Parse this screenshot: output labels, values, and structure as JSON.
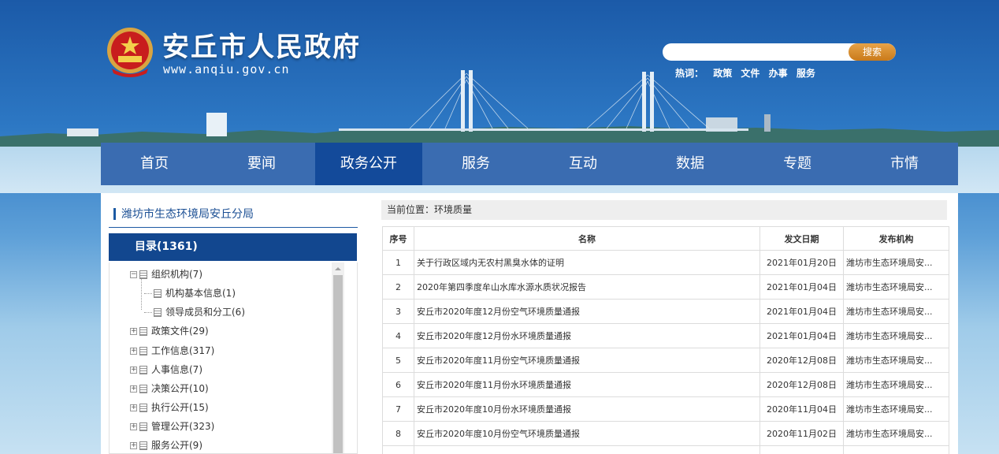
{
  "header": {
    "site_title": "安丘市人民政府",
    "site_url": "www.anqiu.gov.cn",
    "search": {
      "placeholder": "",
      "button_label": "搜索"
    },
    "hotwords": {
      "label": "热词：",
      "items": [
        "政策",
        "文件",
        "办事",
        "服务"
      ]
    },
    "emblem_icon": "national-emblem-icon"
  },
  "nav": {
    "items": [
      "首页",
      "要闻",
      "政务公开",
      "服务",
      "互动",
      "数据",
      "专题",
      "市情"
    ],
    "active_index": 2,
    "colors": {
      "bar": "#3a6cb1",
      "active": "#134a9a"
    }
  },
  "sidebar": {
    "department": "潍坊市生态环境局安丘分局",
    "directory_label": "目录(1361)",
    "tree": [
      {
        "label": "组织机构(7)",
        "expanded": true,
        "level": 0
      },
      {
        "label": "机构基本信息(1)",
        "level": 1
      },
      {
        "label": "领导成员和分工(6)",
        "level": 1
      },
      {
        "label": "政策文件(29)",
        "expanded": false,
        "level": 0
      },
      {
        "label": "工作信息(317)",
        "expanded": false,
        "level": 0
      },
      {
        "label": "人事信息(7)",
        "expanded": false,
        "level": 0
      },
      {
        "label": "决策公开(10)",
        "expanded": false,
        "level": 0
      },
      {
        "label": "执行公开(15)",
        "expanded": false,
        "level": 0
      },
      {
        "label": "管理公开(323)",
        "expanded": false,
        "level": 0
      },
      {
        "label": "服务公开(9)",
        "expanded": false,
        "level": 0
      }
    ]
  },
  "main": {
    "breadcrumb": "当前位置：环境质量",
    "columns": [
      "序号",
      "名称",
      "发文日期",
      "发布机构"
    ],
    "rows": [
      {
        "no": "1",
        "title": "关于行政区域内无农村黑臭水体的证明",
        "date": "2021年01月20日",
        "org": "潍坊市生态环境局安..."
      },
      {
        "no": "2",
        "title": "2020年第四季度牟山水库水源水质状况报告",
        "date": "2021年01月04日",
        "org": "潍坊市生态环境局安..."
      },
      {
        "no": "3",
        "title": "安丘市2020年度12月份空气环境质量通报",
        "date": "2021年01月04日",
        "org": "潍坊市生态环境局安..."
      },
      {
        "no": "4",
        "title": "安丘市2020年度12月份水环境质量通报",
        "date": "2021年01月04日",
        "org": "潍坊市生态环境局安..."
      },
      {
        "no": "5",
        "title": "安丘市2020年度11月份空气环境质量通报",
        "date": "2020年12月08日",
        "org": "潍坊市生态环境局安..."
      },
      {
        "no": "6",
        "title": "安丘市2020年度11月份水环境质量通报",
        "date": "2020年12月08日",
        "org": "潍坊市生态环境局安..."
      },
      {
        "no": "7",
        "title": "安丘市2020年度10月份水环境质量通报",
        "date": "2020年11月04日",
        "org": "潍坊市生态环境局安..."
      },
      {
        "no": "8",
        "title": "安丘市2020年度10月份空气环境质量通报",
        "date": "2020年11月02日",
        "org": "潍坊市生态环境局安..."
      }
    ]
  }
}
